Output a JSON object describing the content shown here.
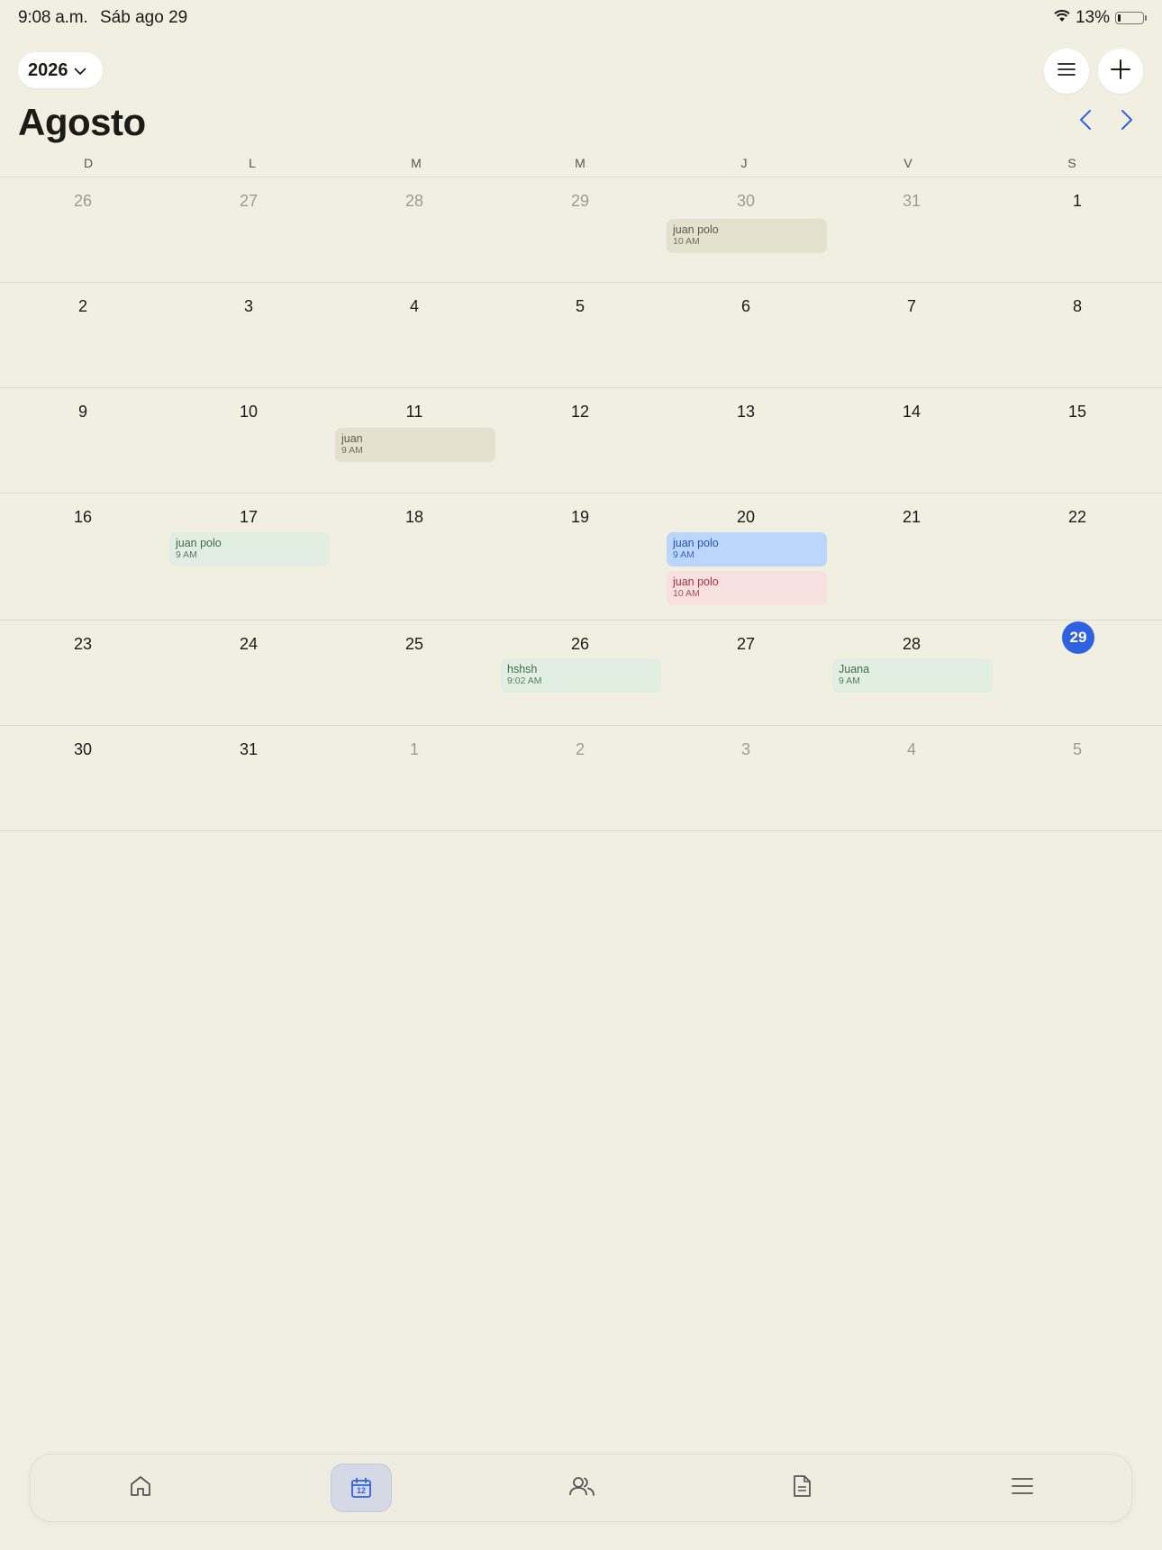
{
  "status_bar": {
    "time": "9:08 a.m.",
    "date": "Sáb ago 29",
    "battery": "13%",
    "battery_level": 0.13
  },
  "header": {
    "year": "2026",
    "month": "Agosto"
  },
  "weekdays": [
    "D",
    "L",
    "M",
    "M",
    "J",
    "V",
    "S"
  ],
  "weeks": [
    [
      "26",
      "27",
      "28",
      "29",
      "30",
      "31",
      "1"
    ],
    [
      "2",
      "3",
      "4",
      "5",
      "6",
      "7",
      "8"
    ],
    [
      "9",
      "10",
      "11",
      "12",
      "13",
      "14",
      "15"
    ],
    [
      "16",
      "17",
      "18",
      "19",
      "20",
      "21",
      "22"
    ],
    [
      "23",
      "24",
      "25",
      "26",
      "27",
      "28",
      "29"
    ],
    [
      "30",
      "31",
      "1",
      "2",
      "3",
      "4",
      "5"
    ]
  ],
  "events": [
    {
      "title": "juan polo",
      "time": "10 AM"
    },
    {
      "title": "juan",
      "time": "9 AM"
    },
    {
      "title": "juan polo",
      "time": "9 AM"
    },
    {
      "title": "juan polo",
      "time": "9 AM"
    },
    {
      "title": "juan polo",
      "time": "10 AM"
    },
    {
      "title": "hshsh",
      "time": "9:02 AM"
    },
    {
      "title": "Juana",
      "time": "9 AM"
    }
  ],
  "colors": {
    "background": "#f1efe2",
    "accent": "#2e62e0",
    "event_olive": "#e4e1cf",
    "event_mint": "#e3eee2",
    "event_blue": "#bcd6fb",
    "event_pink": "#f8e0e0"
  },
  "tabs": [
    "home-icon",
    "calendar-icon",
    "people-icon",
    "document-icon",
    "menu-icon"
  ],
  "tab_calendar_day": "12"
}
